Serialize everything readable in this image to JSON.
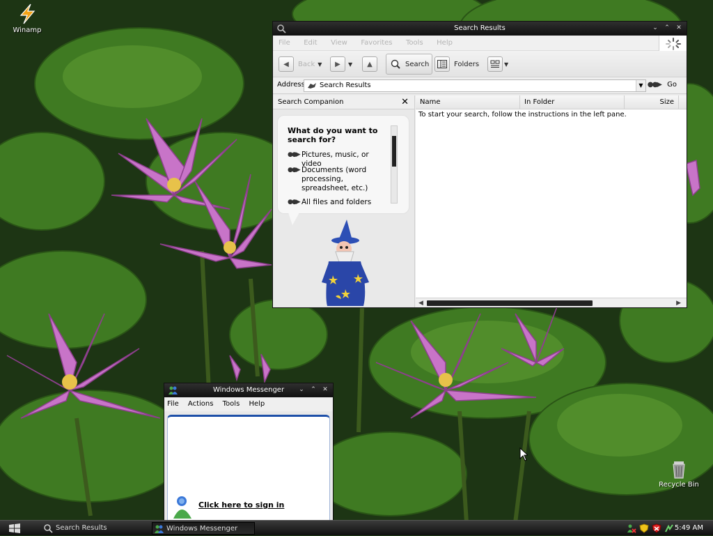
{
  "desktop": {
    "icons": [
      {
        "label": "Winamp",
        "icon": "winamp-icon"
      },
      {
        "label": "Recycle Bin",
        "icon": "recycle-bin-icon"
      }
    ]
  },
  "search_window": {
    "title": "Search Results",
    "menu": [
      "File",
      "Edit",
      "View",
      "Favorites",
      "Tools",
      "Help"
    ],
    "toolbar": {
      "back_label": "Back",
      "search_label": "Search",
      "folders_label": "Folders"
    },
    "address": {
      "label": "Address",
      "value": "Search Results",
      "go_label": "Go"
    },
    "companion": {
      "header": "Search Companion",
      "question": "What do you want to search for?",
      "options": [
        "Pictures, music, or video",
        "Documents (word processing, spreadsheet, etc.)",
        "All files and folders"
      ]
    },
    "columns": [
      "Name",
      "In Folder",
      "Size"
    ],
    "empty_message": "To start your search, follow the instructions in the left pane."
  },
  "messenger_window": {
    "title": "Windows Messenger",
    "menu": [
      "File",
      "Actions",
      "Tools",
      "Help"
    ],
    "signin_text": "Click here to sign in"
  },
  "taskbar": {
    "tasks": [
      "Search Results",
      "Windows Messenger"
    ],
    "clock": "5:49 AM"
  },
  "colors": {
    "accent": "#1d4fa8",
    "titlebar": "#1a1a1a",
    "flower": "#c874c8"
  }
}
